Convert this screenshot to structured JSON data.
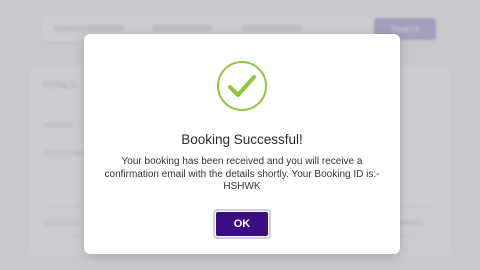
{
  "background": {
    "search_button_label": "Search",
    "section_heading": "TOTALS"
  },
  "modal": {
    "title": "Booking Successful!",
    "message": "Your booking has been received and you will receive a confirmation email with the details shortly. Your Booking ID is:- HSHWK",
    "ok_label": "OK",
    "icon": "check-circle-icon"
  },
  "colors": {
    "accent": "#3b0f83",
    "success": "#8dc63f"
  }
}
